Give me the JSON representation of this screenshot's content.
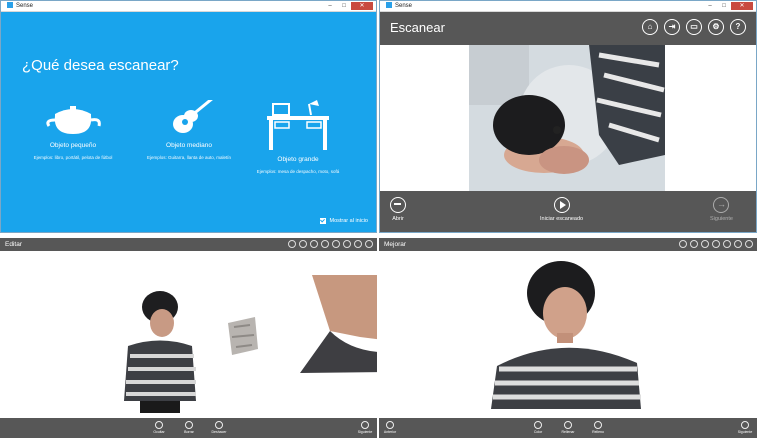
{
  "panel1": {
    "window_title": "Sense",
    "heading": "¿Qué desea escanear?",
    "categories": [
      {
        "label": "Objeto pequeño",
        "example": "Ejemplos: libro, portátil, pelota de fútbol"
      },
      {
        "label": "Objeto mediano",
        "example": "Ejemplos: Guitarra, llanta de auto, maletín"
      },
      {
        "label": "Objeto grande",
        "example": "Ejemplos: mesa de despacho, moto, sofá"
      }
    ],
    "show_at_start": "Mostrar al inicio"
  },
  "panel2": {
    "window_title": "Sense",
    "title": "Escanear",
    "open_label": "Abrir",
    "start_label": "Iniciar escaneado",
    "next_label": "Siguiente"
  },
  "panel3": {
    "title": "Editar",
    "buttons": [
      "Ocultar",
      "Borrar",
      "Deshacer"
    ],
    "next_label": "Siguiente"
  },
  "panel4": {
    "title": "Mejorar",
    "back_label": "Anterior",
    "buttons": [
      "Color",
      "Rellenar",
      "Relleno"
    ],
    "next_label": "Siguiente"
  },
  "colors": {
    "accent_blue": "#19a4ec",
    "app_bar_gray": "#575757",
    "close_red": "#c94a3f"
  }
}
